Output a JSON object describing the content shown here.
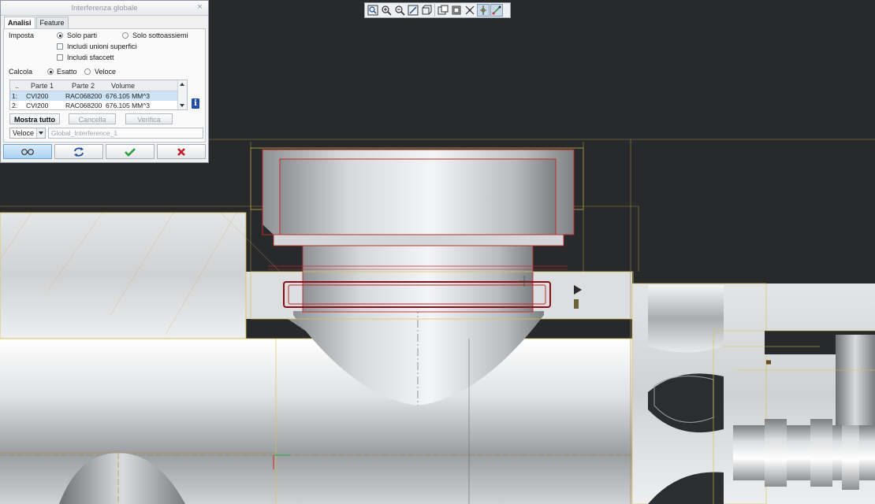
{
  "dialog": {
    "title": "Interferenza globale",
    "tabs": [
      {
        "label": "Analisi",
        "active": true
      },
      {
        "label": "Feature",
        "active": false
      }
    ],
    "setup_label": "Imposta",
    "option_parts": "Solo parti",
    "option_subassemblies": "Solo sottoassiemi",
    "check_surface_quilts": "Includi unioni superfici",
    "check_facets": "Includi sfaccett",
    "compute_label": "Calcola",
    "compute_exact": "Esatto",
    "compute_quick": "Veloce",
    "table": {
      "headers": [
        "..",
        "Parte 1",
        "Parte 2",
        "Volume"
      ],
      "rows": [
        {
          "idx": "1:",
          "part1": "CVI200",
          "part2": "RAC068200",
          "volume": "676.105 MM^3",
          "selected": true
        },
        {
          "idx": "2:",
          "part1": "CVI200",
          "part2": "RAC068200",
          "volume": "676.105 MM^3",
          "selected": false
        }
      ]
    },
    "btn_show_all": "Mostra tutto",
    "btn_clear": "Cancella",
    "btn_verify": "Verifica",
    "mode_value": "Veloce",
    "name_value": "Global_Interference_1"
  },
  "toolbar": {
    "icons": [
      "zoom-refit-icon",
      "zoom-in-icon",
      "zoom-out-icon",
      "repaint-icon",
      "orient-icon",
      "saved-views-icon",
      "display-style-icon",
      "datum-display-icon",
      "spin-center-icon",
      "annotation-display-icon"
    ]
  },
  "colors": {
    "background": "#27292b",
    "interference_red": "#c0282c",
    "edge_yellow": "#d8c24a",
    "ok_green": "#2e9e3e",
    "cancel_red": "#c0202a"
  }
}
